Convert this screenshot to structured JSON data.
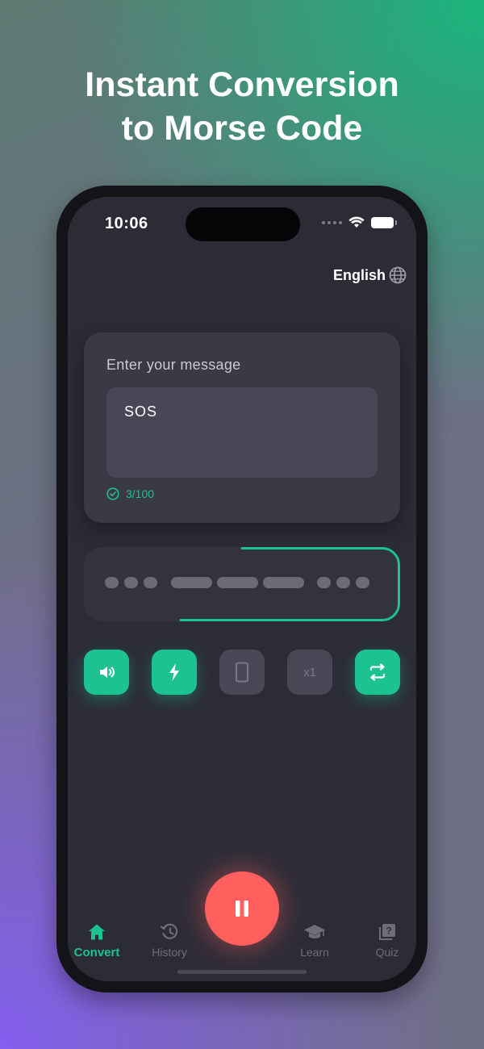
{
  "headline": {
    "line1": "Instant Conversion",
    "line2": "to Morse Code"
  },
  "status_bar": {
    "time": "10:06",
    "icons": [
      "signal-dots-icon",
      "wifi-icon",
      "battery-icon"
    ]
  },
  "language": {
    "label": "English",
    "icon": "globe-icon"
  },
  "input_card": {
    "label": "Enter your message",
    "value": "SOS",
    "counter": "3/100",
    "counter_icon": "check-circle-icon"
  },
  "morse_output": {
    "marks": [
      "dot",
      "dot",
      "dot",
      "gap",
      "dash",
      "dash",
      "dash",
      "gap",
      "dot",
      "dot",
      "dot"
    ],
    "accent_color": "#1cc290"
  },
  "controls": [
    {
      "name": "sound",
      "icon": "speaker-icon",
      "active": true
    },
    {
      "name": "flash",
      "icon": "flash-icon",
      "active": true
    },
    {
      "name": "vibrate",
      "icon": "phone-icon",
      "active": false
    },
    {
      "name": "speed",
      "label": "x1",
      "active": false
    },
    {
      "name": "swap",
      "icon": "swap-arrows-icon",
      "active": true
    }
  ],
  "play_button": {
    "icon": "pause-icon",
    "color": "#ff5f5d"
  },
  "tabs": [
    {
      "label": "Convert",
      "icon": "home-icon",
      "active": true
    },
    {
      "label": "History",
      "icon": "history-icon",
      "active": false
    },
    {
      "label": "Learn",
      "icon": "graduation-cap-icon",
      "active": false
    },
    {
      "label": "Quiz",
      "icon": "quiz-icon",
      "active": false
    }
  ],
  "colors": {
    "accent": "#1cc290",
    "background": "#2c2c37",
    "card": "#3a3a47"
  }
}
